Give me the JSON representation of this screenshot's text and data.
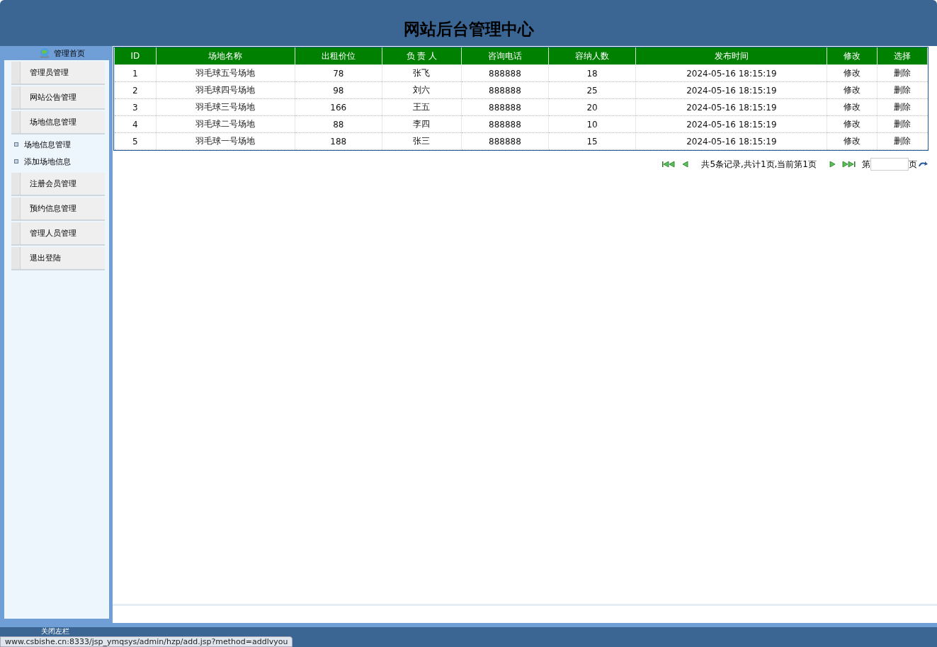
{
  "header": {
    "title": "网站后台管理中心"
  },
  "sidebar": {
    "home": "管理首页",
    "items": [
      {
        "label": "管理员管理"
      },
      {
        "label": "网站公告管理"
      },
      {
        "label": "场地信息管理",
        "children": [
          {
            "label": "场地信息管理"
          },
          {
            "label": "添加场地信息"
          }
        ]
      },
      {
        "label": "注册会员管理"
      },
      {
        "label": "预约信息管理"
      },
      {
        "label": "管理人员管理"
      },
      {
        "label": "退出登陆"
      }
    ]
  },
  "table": {
    "columns": [
      "ID",
      "场地名称",
      "出租价位",
      "负 责 人",
      "咨询电话",
      "容纳人数",
      "发布时间",
      "修改",
      "选择"
    ],
    "rows": [
      [
        "1",
        "羽毛球五号场地",
        "78",
        "张飞",
        "888888",
        "18",
        "2024-05-16 18:15:19",
        "修改",
        "删除"
      ],
      [
        "2",
        "羽毛球四号场地",
        "98",
        "刘六",
        "888888",
        "25",
        "2024-05-16 18:15:19",
        "修改",
        "删除"
      ],
      [
        "3",
        "羽毛球三号场地",
        "166",
        "王五",
        "888888",
        "20",
        "2024-05-16 18:15:19",
        "修改",
        "删除"
      ],
      [
        "4",
        "羽毛球二号场地",
        "88",
        "李四",
        "888888",
        "10",
        "2024-05-16 18:15:19",
        "修改",
        "删除"
      ],
      [
        "5",
        "羽毛球一号场地",
        "188",
        "张三",
        "888888",
        "15",
        "2024-05-16 18:15:19",
        "修改",
        "删除"
      ]
    ]
  },
  "pager": {
    "summary": "共5条记录,共计1页,当前第1页",
    "page_prefix": "第",
    "page_suffix": "页"
  },
  "bottom_bar": {
    "toggle": "关闭左栏",
    "status_url": "www.csbishe.cn:8333/jsp_ymqsys/admin/hzp/add.jsp?method=addlvyou"
  }
}
